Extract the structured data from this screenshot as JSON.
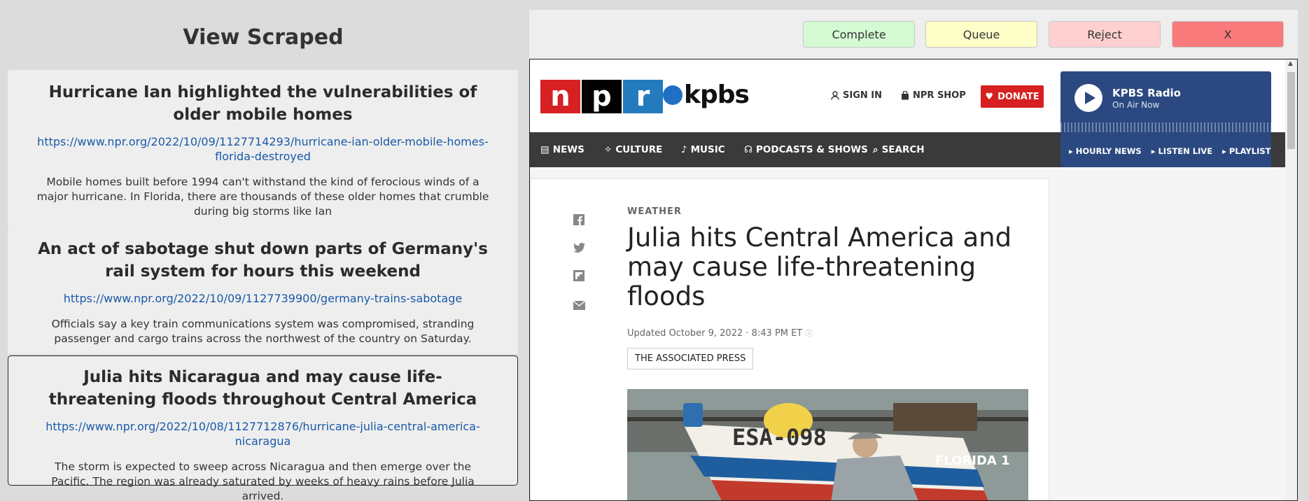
{
  "left": {
    "title": "View Scraped",
    "items": [
      {
        "title": "Hurricane Ian highlighted the vulnerabilities of older mobile homes",
        "url": "https://www.npr.org/2022/10/09/1127714293/hurricane-ian-older-mobile-homes-florida-destroyed",
        "description": "Mobile homes built before 1994 can't withstand the kind of ferocious winds of a major hurricane. In Florida, there are thousands of these older homes that crumble during big storms like Ian"
      },
      {
        "title": "An act of sabotage shut down parts of Germany's rail system for hours this weekend",
        "url": "https://www.npr.org/2022/10/09/1127739900/germany-trains-sabotage",
        "description": "Officials say a key train communications system was compromised, stranding passenger and cargo trains across the northwest of the country on Saturday."
      },
      {
        "title": "Julia hits Nicaragua and may cause life-threatening floods throughout Central America",
        "url": "https://www.npr.org/2022/10/08/1127712876/hurricane-julia-central-america-nicaragua",
        "description": "The storm is expected to sweep across Nicaragua and then emerge over the Pacific. The region was already saturated by weeks of heavy rains before Julia arrived."
      }
    ]
  },
  "toolbar": {
    "complete": "Complete",
    "queue": "Queue",
    "reject": "Reject",
    "close": "X"
  },
  "npr": {
    "logo_letters": [
      "n",
      "p",
      "r"
    ],
    "station": "kpbs",
    "sign_in": "SIGN IN",
    "shop": "NPR SHOP",
    "donate": "DONATE",
    "nav": [
      "NEWS",
      "CULTURE",
      "MUSIC",
      "PODCASTS & SHOWS",
      "SEARCH"
    ],
    "radio": {
      "title": "KPBS Radio",
      "subtitle": "On Air Now",
      "links": [
        "HOURLY NEWS",
        "LISTEN LIVE",
        "PLAYLIST"
      ]
    },
    "article": {
      "kicker": "WEATHER",
      "title": "Julia hits Central America and may cause life-threatening floods",
      "updated": "Updated October 9, 2022 · 8:43 PM ET",
      "byline": "THE ASSOCIATED PRESS",
      "photo_text": [
        "ESA-098",
        "FLORIDA 1"
      ]
    }
  },
  "colors": {
    "npr_red": "#d62021",
    "npr_blue": "#237bbd",
    "radio_bg": "#2b4980",
    "complete_bg": "#d4fad4",
    "queue_bg": "#fefec8",
    "reject_bg": "#ffd0d0",
    "close_bg": "#f97a7a"
  }
}
